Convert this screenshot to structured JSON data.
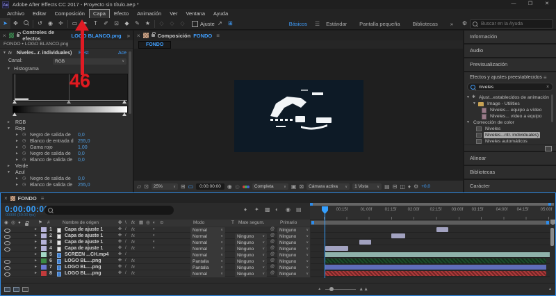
{
  "window": {
    "title": "Adobe After Effects CC 2017 - Proyecto sin título.aep *",
    "logo": "Ae",
    "minimize": "—",
    "restore": "❐",
    "close": "✕"
  },
  "menu": {
    "items": [
      "Archivo",
      "Editar",
      "Composición",
      "Capa",
      "Efecto",
      "Animación",
      "Ver",
      "Ventana",
      "Ayuda"
    ]
  },
  "toolbar": {
    "ajuste": "Ajuste",
    "more": "»",
    "workspaces": [
      "Básicos",
      "Estándar",
      "Pantalla pequeña",
      "Bibliotecas"
    ],
    "active_workspace": "Básicos",
    "help_placeholder": "Buscar en la Ayuda"
  },
  "effect_controls": {
    "tab": "Controles de efectos",
    "file": "LOGO BLANCO.png",
    "breadcrumb": "FONDO • LOGO BLANCO.png",
    "effect_name": "Niveles...r. individuales)",
    "reset": "Rest",
    "about": "Ace",
    "fx": "fx",
    "canal_label": "Canal:",
    "canal_value": "RGB",
    "histograma": "Histograma",
    "rows": [
      {
        "t": "group",
        "arrow": "►",
        "label": "RGB"
      },
      {
        "t": "group",
        "arrow": "▼",
        "label": "Rojo"
      },
      {
        "t": "prop",
        "label": "Negro de salida de",
        "value": "0,0"
      },
      {
        "t": "prop",
        "label": "Blanco de entrada d",
        "value": "255,0"
      },
      {
        "t": "prop",
        "label": "Gama rojo",
        "value": "1,00"
      },
      {
        "t": "prop",
        "label": "Negro de salida de",
        "value": "0,0"
      },
      {
        "t": "prop",
        "label": "Blanco de salida de",
        "value": "0,0"
      },
      {
        "t": "group",
        "arrow": "►",
        "label": "Verde"
      },
      {
        "t": "group",
        "arrow": "▼",
        "label": "Azul"
      },
      {
        "t": "prop",
        "label": "Negro de salida de",
        "value": "0,0"
      },
      {
        "t": "prop",
        "label": "Blanco de salida de",
        "value": "255,0"
      }
    ]
  },
  "composition": {
    "tab": "Composición",
    "comp_name": "FONDO",
    "viewer_tab": "FONDO",
    "zoom": "25%",
    "timecode": "0:00:00:00",
    "resolution": "Completa",
    "camera": "Cámara activa",
    "views": "1 Vista",
    "exposure": "+0,0"
  },
  "right_panel": {
    "informacion": "Información",
    "audio": "Audio",
    "previsualizacion": "Previsualización",
    "efectos_header": "Efectos y ajustes preestablecidos",
    "search_value": "niveles",
    "clear": "×",
    "tree": [
      {
        "type": "root",
        "label": "Ajust...establecidos de animación",
        "selected": false
      },
      {
        "type": "folder",
        "label": "Image - Utilities",
        "selected": false
      },
      {
        "type": "preset",
        "label": "Niveles... equipo a vídeo",
        "selected": false
      },
      {
        "type": "preset",
        "label": "Niveles... vídeo a equipo",
        "selected": false
      },
      {
        "type": "root",
        "label": "Corrección de color",
        "selected": false
      },
      {
        "type": "effect",
        "label": "Niveles",
        "selected": false
      },
      {
        "type": "effect",
        "label": "Niveles...ntr. individuales)",
        "selected": true
      },
      {
        "type": "effect",
        "label": "Niveles automáticos",
        "selected": false
      }
    ],
    "alinear": "Alinear",
    "bibliotecas": "Bibliotecas",
    "caracter": "Carácter"
  },
  "timeline": {
    "tab": "FONDO",
    "timecode": "0:00:00:00",
    "frame_info": "00000 (30.00 fps)",
    "columns": {
      "num": "#",
      "name": "Nombre de origen",
      "mode": "Modo",
      "t": "T",
      "matte": "Mate segum.",
      "parent": "Primario"
    },
    "ruler": [
      "00:15f",
      "01:00f",
      "01:15f",
      "02:00f",
      "02:15f",
      "03:00f",
      "03:15f",
      "04:00f",
      "04:15f",
      "05:00f"
    ],
    "layers": [
      {
        "num": "1",
        "name": "Capa de ajuste 1",
        "mode": "Normal",
        "matte": "",
        "parent": "Ninguno",
        "visible": true,
        "fx": true,
        "adjustment": true,
        "icon": "icon-white",
        "label_color": "#b6b3da",
        "bar_color": "#a2a2c0",
        "hatch": false
      },
      {
        "num": "2",
        "name": "Capa de ajuste 1",
        "mode": "Normal",
        "matte": "Ninguno",
        "parent": "Ninguno",
        "visible": true,
        "fx": true,
        "adjustment": true,
        "icon": "icon-white",
        "label_color": "#b6b3da",
        "bar_color": "#a2a2c0",
        "hatch": false
      },
      {
        "num": "3",
        "name": "Capa de ajuste 1",
        "mode": "Normal",
        "matte": "Ninguno",
        "parent": "Ninguno",
        "visible": true,
        "fx": true,
        "adjustment": true,
        "icon": "icon-white",
        "label_color": "#b6b3da",
        "bar_color": "#a2a2c0",
        "hatch": false
      },
      {
        "num": "4",
        "name": "Capa de ajuste 1",
        "mode": "Normal",
        "matte": "Ninguno",
        "parent": "Ninguno",
        "visible": true,
        "fx": true,
        "adjustment": true,
        "icon": "icon-white",
        "label_color": "#b6b3da",
        "bar_color": "#a2a2c0",
        "hatch": false
      },
      {
        "num": "5",
        "name": "SCREEN ...CH.mp4",
        "mode": "Normal",
        "matte": "Ninguno",
        "parent": "Ninguno",
        "visible": false,
        "fx": false,
        "adjustment": false,
        "icon": "icon-file",
        "label_color": "#a4d8c6",
        "bar_color": "#8fb2ab",
        "hatch": false
      },
      {
        "num": "6",
        "name": "LOGO BL....png",
        "mode": "Pantalla",
        "matte": "Ninguno",
        "parent": "Ninguno",
        "visible": true,
        "fx": true,
        "adjustment": false,
        "icon": "icon-file",
        "label_color": "#3c8a44",
        "bar_color": "#1d4a2a",
        "hatch": true
      },
      {
        "num": "7",
        "name": "LOGO BL....png",
        "mode": "Pantalla",
        "matte": "Ninguno",
        "parent": "Ninguno",
        "visible": true,
        "fx": true,
        "adjustment": false,
        "icon": "icon-file",
        "label_color": "#6b79d1",
        "bar_color": "#5e6db8",
        "hatch": false
      },
      {
        "num": "8",
        "name": "LOGO BL....png",
        "mode": "Normal",
        "matte": "Ninguno",
        "parent": "Ninguno",
        "visible": true,
        "fx": true,
        "adjustment": false,
        "icon": "icon-file",
        "label_color": "#c23b3b",
        "bar_color": "#ad3a3a",
        "hatch": true
      }
    ]
  },
  "annotation": {
    "number": "46",
    "color": "#de1b21"
  }
}
